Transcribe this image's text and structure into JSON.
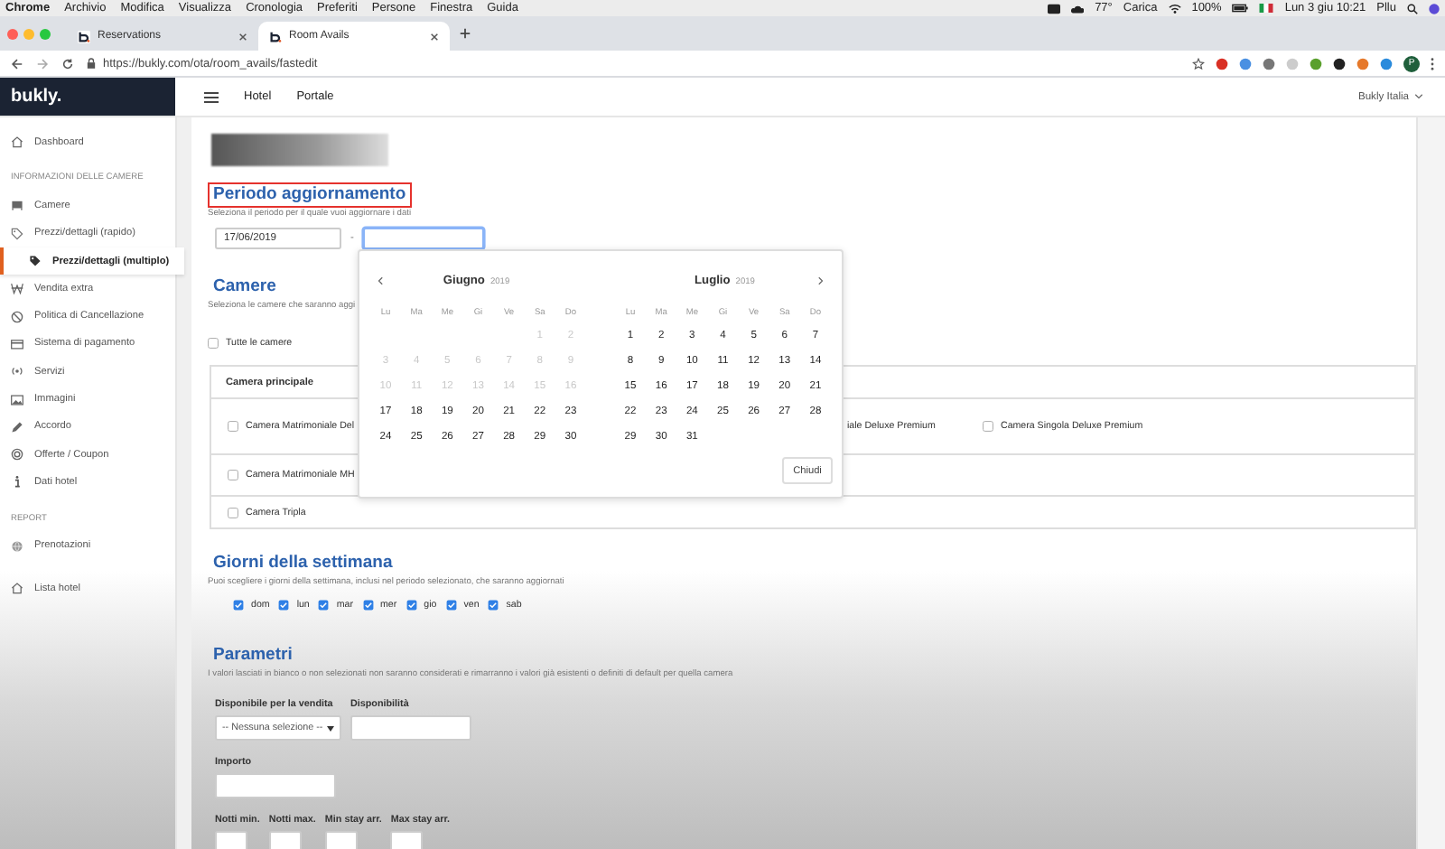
{
  "menubar": {
    "app": "Chrome",
    "menus": [
      "Archivio",
      "Modifica",
      "Visualizza",
      "Cronologia",
      "Preferiti",
      "Persone",
      "Finestra",
      "Guida"
    ],
    "status": [
      "77°",
      "Carica",
      "100%",
      "Lun 3 giu  10:21",
      "Pllu"
    ]
  },
  "browser": {
    "tabs": [
      {
        "label": "Reservations",
        "selected": false
      },
      {
        "label": "Room Avails",
        "selected": true
      }
    ],
    "url": "https://bukly.com/ota/room_avails/fastedit",
    "profile": "P"
  },
  "app": {
    "logo": "bukly.",
    "nav": [
      "Hotel",
      "Portale"
    ],
    "account": "Bukly Italia"
  },
  "sidebar": {
    "items": [
      {
        "kind": "link",
        "label": "Dashboard",
        "selected": false
      },
      {
        "kind": "heading",
        "label": "INFORMAZIONI DELLE CAMERE"
      },
      {
        "kind": "link",
        "label": "Camere",
        "selected": false
      },
      {
        "kind": "link",
        "label": "Prezzi/dettagli (rapido)",
        "selected": false
      },
      {
        "kind": "link",
        "label": "Prezzi/dettagli (multiplo)",
        "selected": true
      },
      {
        "kind": "link",
        "label": "Vendita extra",
        "selected": false
      },
      {
        "kind": "link",
        "label": "Politica di Cancellazione",
        "selected": false
      },
      {
        "kind": "link",
        "label": "Sistema di pagamento",
        "selected": false
      },
      {
        "kind": "link",
        "label": "Servizi",
        "selected": false
      },
      {
        "kind": "link",
        "label": "Immagini",
        "selected": false
      },
      {
        "kind": "link",
        "label": "Accordo",
        "selected": false
      },
      {
        "kind": "link",
        "label": "Offerte / Coupon",
        "selected": false
      },
      {
        "kind": "link",
        "label": "Dati hotel",
        "selected": false
      },
      {
        "kind": "heading",
        "label": "REPORT"
      },
      {
        "kind": "link",
        "label": "Prenotazioni",
        "selected": false
      },
      {
        "kind": "link",
        "label": "Lista hotel",
        "selected": false
      }
    ]
  },
  "period": {
    "title": "Periodo aggiornamento",
    "highlighted": true,
    "hint": "Seleziona il periodo per il quale vuoi aggiornare i dati",
    "from": "17/06/2019",
    "separator": "-"
  },
  "datepicker": {
    "close": "Chiudi",
    "months": [
      {
        "name": "Giugno",
        "year": "2019",
        "weekdays": [
          "Lu",
          "Ma",
          "Me",
          "Gi",
          "Ve",
          "Sa",
          "Do"
        ],
        "weeks": [
          [
            {
              "d": "1",
              "disabled": true
            },
            {
              "d": "2",
              "disabled": true
            }
          ],
          [
            {
              "d": "3",
              "disabled": true
            },
            {
              "d": "4",
              "disabled": true
            },
            {
              "d": "5",
              "disabled": true
            },
            {
              "d": "6",
              "disabled": true
            },
            {
              "d": "7",
              "disabled": true
            },
            {
              "d": "8",
              "disabled": true
            },
            {
              "d": "9",
              "disabled": true
            }
          ],
          [
            {
              "d": "10",
              "disabled": true
            },
            {
              "d": "11",
              "disabled": true
            },
            {
              "d": "12",
              "disabled": true
            },
            {
              "d": "13",
              "disabled": true
            },
            {
              "d": "14",
              "disabled": true
            },
            {
              "d": "15",
              "disabled": true
            },
            {
              "d": "16",
              "disabled": true
            }
          ],
          [
            {
              "d": "17",
              "disabled": false
            },
            {
              "d": "18",
              "disabled": false
            },
            {
              "d": "19",
              "disabled": false
            },
            {
              "d": "20",
              "disabled": false
            },
            {
              "d": "21",
              "disabled": false
            },
            {
              "d": "22",
              "disabled": false
            },
            {
              "d": "23",
              "disabled": false
            }
          ],
          [
            {
              "d": "24",
              "disabled": false
            },
            {
              "d": "25",
              "disabled": false
            },
            {
              "d": "26",
              "disabled": false
            },
            {
              "d": "27",
              "disabled": false
            },
            {
              "d": "28",
              "disabled": false
            },
            {
              "d": "29",
              "disabled": false
            },
            {
              "d": "30",
              "disabled": false
            }
          ]
        ]
      },
      {
        "name": "Luglio",
        "year": "2019",
        "weekdays": [
          "Lu",
          "Ma",
          "Me",
          "Gi",
          "Ve",
          "Sa",
          "Do"
        ],
        "weeks": [
          [
            {
              "d": "1",
              "disabled": false
            },
            {
              "d": "2",
              "disabled": false
            },
            {
              "d": "3",
              "disabled": false
            },
            {
              "d": "4",
              "disabled": false
            },
            {
              "d": "5",
              "disabled": false
            },
            {
              "d": "6",
              "disabled": false
            },
            {
              "d": "7",
              "disabled": false
            }
          ],
          [
            {
              "d": "8",
              "disabled": false
            },
            {
              "d": "9",
              "disabled": false
            },
            {
              "d": "10",
              "disabled": false
            },
            {
              "d": "11",
              "disabled": false
            },
            {
              "d": "12",
              "disabled": false
            },
            {
              "d": "13",
              "disabled": false
            },
            {
              "d": "14",
              "disabled": false
            }
          ],
          [
            {
              "d": "15",
              "disabled": false
            },
            {
              "d": "16",
              "disabled": false
            },
            {
              "d": "17",
              "disabled": false
            },
            {
              "d": "18",
              "disabled": false
            },
            {
              "d": "19",
              "disabled": false
            },
            {
              "d": "20",
              "disabled": false
            },
            {
              "d": "21",
              "disabled": false
            }
          ],
          [
            {
              "d": "22",
              "disabled": false
            },
            {
              "d": "23",
              "disabled": false
            },
            {
              "d": "24",
              "disabled": false
            },
            {
              "d": "25",
              "disabled": false
            },
            {
              "d": "26",
              "disabled": false
            },
            {
              "d": "27",
              "disabled": false
            },
            {
              "d": "28",
              "disabled": false
            }
          ],
          [
            {
              "d": "29",
              "disabled": false
            },
            {
              "d": "30",
              "disabled": false
            },
            {
              "d": "31",
              "disabled": false
            }
          ]
        ]
      }
    ]
  },
  "rooms": {
    "title": "Camere",
    "hint": "Seleziona le camere che saranno aggi",
    "all": {
      "label": "Tutte le camere",
      "checked": false
    },
    "table_header": "Camera principale",
    "rows": [
      [
        {
          "kind": "room",
          "label": "Camera Matrimoniale Del",
          "checked": false
        },
        {
          "kind": "fragment",
          "label": "iale Deluxe Premium"
        },
        {
          "kind": "room",
          "label": "Camera Singola Deluxe Premium",
          "checked": false
        }
      ],
      [
        {
          "kind": "room",
          "label": "Camera Matrimoniale MH",
          "checked": false
        }
      ],
      [
        {
          "kind": "room",
          "label": "Camera Tripla",
          "checked": false
        }
      ]
    ]
  },
  "weekdays": {
    "title": "Giorni della settimana",
    "hint": "Puoi scegliere i giorni della settimana, inclusi nel periodo selezionato, che saranno aggiornati",
    "days": [
      {
        "label": "dom",
        "checked": true
      },
      {
        "label": "lun",
        "checked": true
      },
      {
        "label": "mar",
        "checked": true
      },
      {
        "label": "mer",
        "checked": true
      },
      {
        "label": "gio",
        "checked": true
      },
      {
        "label": "ven",
        "checked": true
      },
      {
        "label": "sab",
        "checked": true
      }
    ]
  },
  "params": {
    "title": "Parametri",
    "hint": "I valori lasciati in bianco o non selezionati non saranno considerati e rimarranno i valori già esistenti o definiti di default per quella camera",
    "rows": [
      [
        {
          "kind": "select",
          "label": "Disponibile per la vendita",
          "value": "-- Nessuna selezione --"
        },
        {
          "kind": "input",
          "label": "Disponibilità"
        }
      ],
      [
        {
          "kind": "input",
          "label": "Importo"
        }
      ],
      [
        {
          "kind": "small",
          "label": "Notti min."
        },
        {
          "kind": "small",
          "label": "Notti max."
        },
        {
          "kind": "small",
          "label": "Min stay arr."
        },
        {
          "kind": "small",
          "label": "Max stay arr."
        }
      ]
    ]
  }
}
